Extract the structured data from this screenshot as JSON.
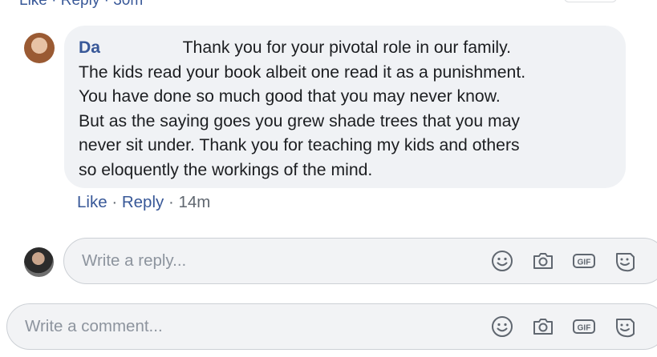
{
  "previous_comment": {
    "actions_text": "Like · Reply · 30m"
  },
  "comment": {
    "author": "Da",
    "text": "Thank you for your pivotal role in our family.\nThe kids read your book albeit one read it as a punishment.\nYou have done so much good that you may never know.\nBut as the saying goes you grew shade trees that you may\nnever sit under. Thank you for teaching my kids and others\nso eloquently the workings of the mind.",
    "like_label": "Like",
    "reply_label": "Reply",
    "separator": "·",
    "timestamp": "14m"
  },
  "reply_input": {
    "placeholder": "Write a reply...",
    "icons": [
      "emoji-icon",
      "camera-icon",
      "gif-icon",
      "sticker-icon"
    ]
  },
  "comment_input": {
    "placeholder": "Write a comment...",
    "icons": [
      "emoji-icon",
      "camera-icon",
      "gif-icon",
      "sticker-icon"
    ]
  },
  "icon_labels": {
    "gif": "GIF"
  },
  "colors": {
    "link": "#385898",
    "bubble": "#f0f2f5",
    "meta_text": "#606770",
    "placeholder": "#8d949e",
    "icon": "#606770"
  }
}
